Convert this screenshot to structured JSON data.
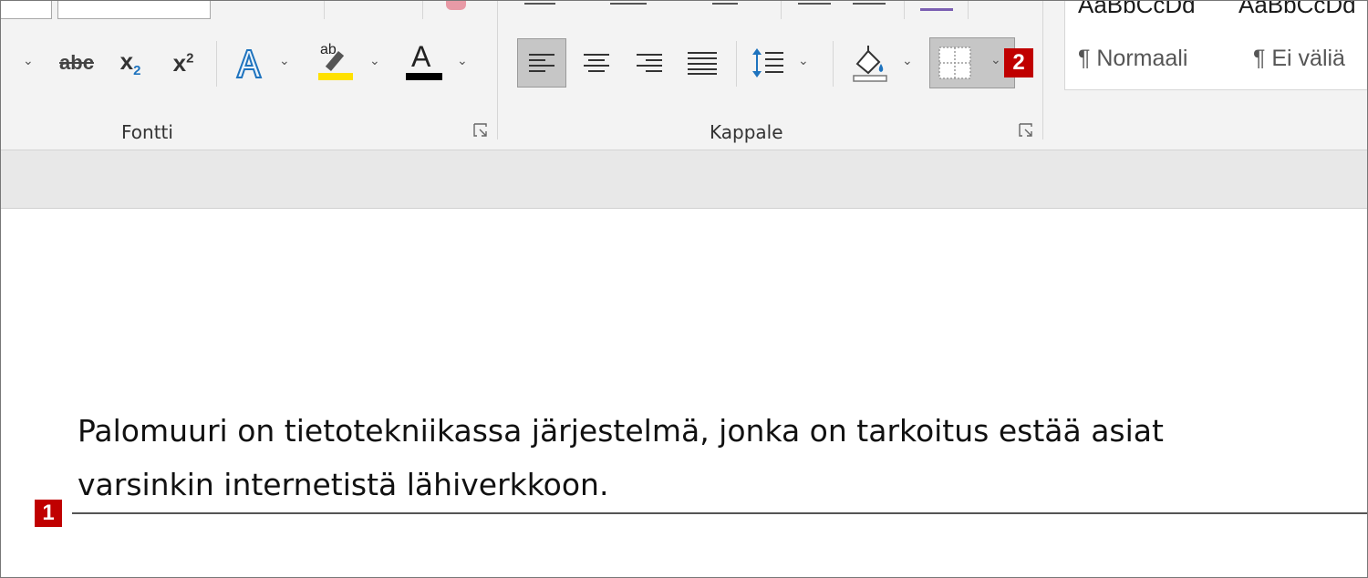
{
  "ribbon": {
    "groups": {
      "font": {
        "label": "Fontti"
      },
      "paragraph": {
        "label": "Kappale"
      }
    },
    "font_buttons": {
      "strikethrough": "abc",
      "subscript_base": "x",
      "subscript_sub": "2",
      "superscript_base": "x",
      "superscript_sup": "2",
      "highlight_top": "ab",
      "font_color_letter": "A"
    },
    "styles": [
      {
        "sample": "AaBbCcDd",
        "name": "¶ Normaali"
      },
      {
        "sample": "AaBbCcDd",
        "name": "¶ Ei väliä"
      }
    ]
  },
  "callouts": {
    "first": "1",
    "second": "2"
  },
  "document": {
    "line1": "Palomuuri on tietotekniikassa järjestelmä, jonka on tarkoitus estää asiat",
    "line2": "varsinkin internetistä lähiverkkoon."
  },
  "colors": {
    "highlight": "#ffe100",
    "font_color": "#000000",
    "text_effect": "#1e73be",
    "badge": "#c00000"
  }
}
